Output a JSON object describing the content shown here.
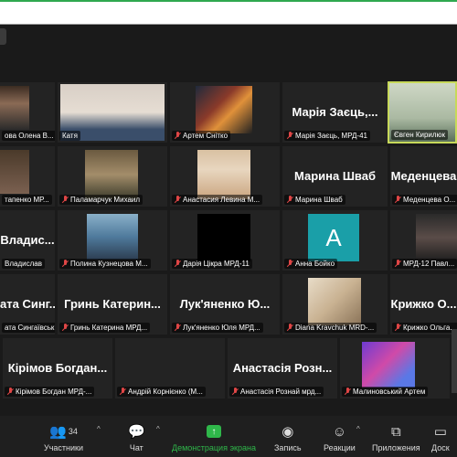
{
  "tiles": {
    "r1": [
      "ова Олена В...",
      "Катя",
      "Артем Снітко",
      "Марія Заєць, МРД-41",
      "Євген Кирилюк"
    ],
    "r1_big": {
      "maria": "Марія Заєць,..."
    },
    "r2": [
      "тапенко МР...",
      "Паламарчук Михаил",
      "Анастасия Левина М...",
      "Марина Шваб",
      "Меденцева О..."
    ],
    "r2_big": {
      "marina": "Марина Шваб",
      "medentseva": "Меденцева"
    },
    "r3": [
      "Владислав",
      "Полина Кузнецова М...",
      "Дарія Цікра МРД-11",
      "Анна Бойко",
      "МРД-12 Павл..."
    ],
    "r3_big": {
      "vladyslav": "Владис..."
    },
    "anna_avatar_letter": "A",
    "r4": [
      "ата Сингаївськ...",
      "Гринь Катерина МРД...",
      "Лук'яненко Юля МРД...",
      "Diana Kravchuk MRD-...",
      "Крижко Ольга..."
    ],
    "r4_big": {
      "syng": "ата Синг...",
      "hryn": "Гринь Катерин...",
      "lukyan": "Лук'яненко Ю...",
      "kryzhko": "Крижко О..."
    },
    "r5": [
      "Кірімов Богдан МРД-...",
      "Андрій Корнієнко (М...",
      "Анастасія Рознай мрд...",
      "Малиновський Артем"
    ],
    "r5_big": {
      "kirimov": "Кірімов Богдан...",
      "roznai": "Анастасія Розн..."
    }
  },
  "toolbar": {
    "participants_label": "Участники",
    "participants_count": "34",
    "chat_label": "Чат",
    "share_label": "Демонстрация экрана",
    "record_label": "Запись",
    "reactions_label": "Реакции",
    "apps_label": "Приложения",
    "whiteboard_label": "Доск"
  },
  "colors": {
    "background": "#1a1a1a",
    "tile": "#232323",
    "share_green": "#2fb74a",
    "active_speaker": "#c7d95a",
    "muted_red": "#e04646",
    "avatar_teal": "#1a9fa8"
  }
}
